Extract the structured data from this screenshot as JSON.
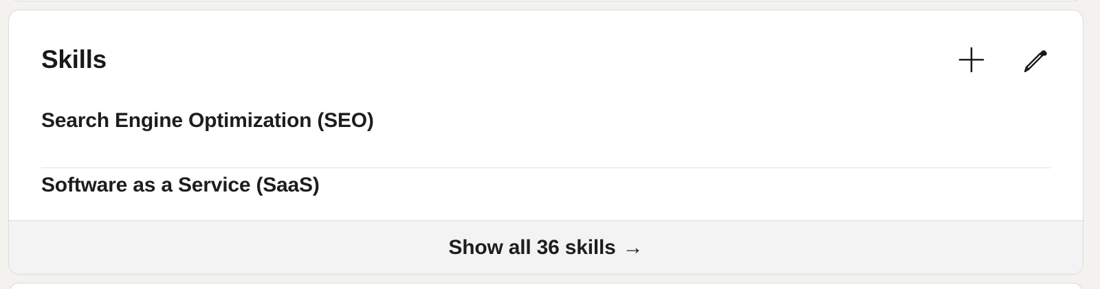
{
  "skills_section": {
    "title": "Skills",
    "actions": {
      "add_icon": "plus-icon",
      "edit_icon": "pencil-icon"
    },
    "items": [
      {
        "label": "Search Engine Optimization (SEO)"
      },
      {
        "label": "Software as a Service (SaaS)"
      }
    ],
    "footer": {
      "label": "Show all 36 skills",
      "arrow": "→"
    }
  },
  "colors": {
    "page_background": "#f4f2ee",
    "card_background": "#ffffff",
    "footer_background": "#f3f3f3",
    "text": "#191919",
    "divider": "#e3e1dd"
  }
}
